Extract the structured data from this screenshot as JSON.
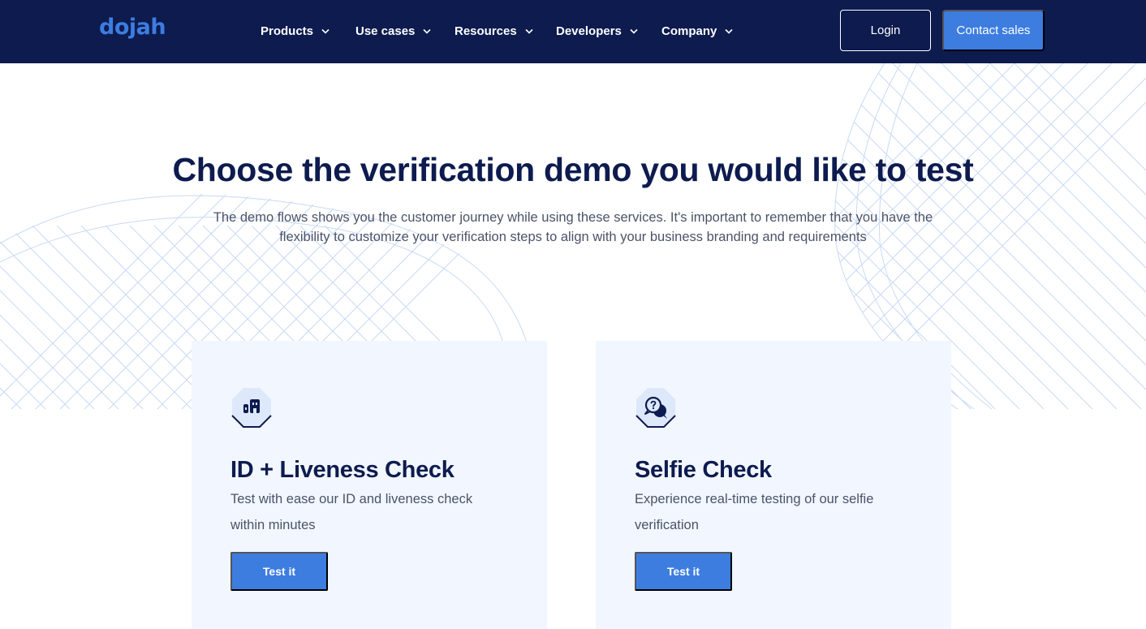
{
  "brand": {
    "logo_text": "dojah"
  },
  "nav": {
    "items": [
      {
        "label": "Products"
      },
      {
        "label": "Use cases"
      },
      {
        "label": "Resources"
      },
      {
        "label": "Developers"
      },
      {
        "label": "Company"
      }
    ],
    "login_label": "Login",
    "contact_label": "Contact sales"
  },
  "hero": {
    "title": "Choose the verification demo you would like to test",
    "subtitle": "The demo flows shows you the customer journey while using these services. It's important to remember that you have the flexibility to customize your verification steps to align with your business branding and requirements"
  },
  "cards": [
    {
      "icon": "building-icon",
      "title": "ID + Liveness Check",
      "description": "Test with ease our ID and liveness check within minutes",
      "button_label": "Test it"
    },
    {
      "icon": "chat-question-icon",
      "title": "Selfie Check",
      "description": "Experience real-time testing of our selfie verification",
      "button_label": "Test it"
    }
  ],
  "colors": {
    "navy": "#0d1b4f",
    "accent": "#3d7de0",
    "card_bg": "#f2f6fe",
    "body_text": "#4b5368"
  }
}
